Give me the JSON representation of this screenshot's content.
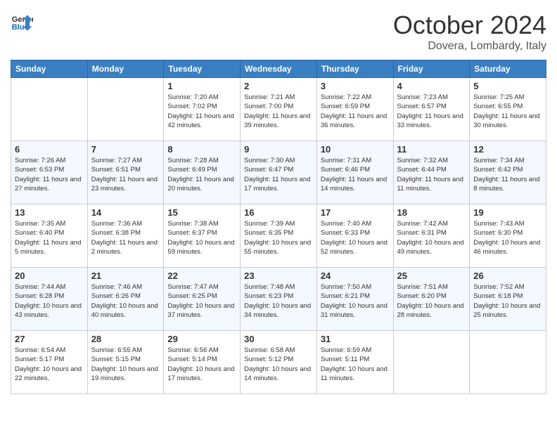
{
  "header": {
    "logo_line1": "General",
    "logo_line2": "Blue",
    "month_title": "October 2024",
    "subtitle": "Dovera, Lombardy, Italy"
  },
  "weekdays": [
    "Sunday",
    "Monday",
    "Tuesday",
    "Wednesday",
    "Thursday",
    "Friday",
    "Saturday"
  ],
  "weeks": [
    [
      {
        "day": "",
        "info": ""
      },
      {
        "day": "",
        "info": ""
      },
      {
        "day": "1",
        "info": "Sunrise: 7:20 AM\nSunset: 7:02 PM\nDaylight: 11 hours and 42 minutes."
      },
      {
        "day": "2",
        "info": "Sunrise: 7:21 AM\nSunset: 7:00 PM\nDaylight: 11 hours and 39 minutes."
      },
      {
        "day": "3",
        "info": "Sunrise: 7:22 AM\nSunset: 6:59 PM\nDaylight: 11 hours and 36 minutes."
      },
      {
        "day": "4",
        "info": "Sunrise: 7:23 AM\nSunset: 6:57 PM\nDaylight: 11 hours and 33 minutes."
      },
      {
        "day": "5",
        "info": "Sunrise: 7:25 AM\nSunset: 6:55 PM\nDaylight: 11 hours and 30 minutes."
      }
    ],
    [
      {
        "day": "6",
        "info": "Sunrise: 7:26 AM\nSunset: 6:53 PM\nDaylight: 11 hours and 27 minutes."
      },
      {
        "day": "7",
        "info": "Sunrise: 7:27 AM\nSunset: 6:51 PM\nDaylight: 11 hours and 23 minutes."
      },
      {
        "day": "8",
        "info": "Sunrise: 7:28 AM\nSunset: 6:49 PM\nDaylight: 11 hours and 20 minutes."
      },
      {
        "day": "9",
        "info": "Sunrise: 7:30 AM\nSunset: 6:47 PM\nDaylight: 11 hours and 17 minutes."
      },
      {
        "day": "10",
        "info": "Sunrise: 7:31 AM\nSunset: 6:46 PM\nDaylight: 11 hours and 14 minutes."
      },
      {
        "day": "11",
        "info": "Sunrise: 7:32 AM\nSunset: 6:44 PM\nDaylight: 11 hours and 11 minutes."
      },
      {
        "day": "12",
        "info": "Sunrise: 7:34 AM\nSunset: 6:42 PM\nDaylight: 11 hours and 8 minutes."
      }
    ],
    [
      {
        "day": "13",
        "info": "Sunrise: 7:35 AM\nSunset: 6:40 PM\nDaylight: 11 hours and 5 minutes."
      },
      {
        "day": "14",
        "info": "Sunrise: 7:36 AM\nSunset: 6:38 PM\nDaylight: 11 hours and 2 minutes."
      },
      {
        "day": "15",
        "info": "Sunrise: 7:38 AM\nSunset: 6:37 PM\nDaylight: 10 hours and 59 minutes."
      },
      {
        "day": "16",
        "info": "Sunrise: 7:39 AM\nSunset: 6:35 PM\nDaylight: 10 hours and 55 minutes."
      },
      {
        "day": "17",
        "info": "Sunrise: 7:40 AM\nSunset: 6:33 PM\nDaylight: 10 hours and 52 minutes."
      },
      {
        "day": "18",
        "info": "Sunrise: 7:42 AM\nSunset: 6:31 PM\nDaylight: 10 hours and 49 minutes."
      },
      {
        "day": "19",
        "info": "Sunrise: 7:43 AM\nSunset: 6:30 PM\nDaylight: 10 hours and 46 minutes."
      }
    ],
    [
      {
        "day": "20",
        "info": "Sunrise: 7:44 AM\nSunset: 6:28 PM\nDaylight: 10 hours and 43 minutes."
      },
      {
        "day": "21",
        "info": "Sunrise: 7:46 AM\nSunset: 6:26 PM\nDaylight: 10 hours and 40 minutes."
      },
      {
        "day": "22",
        "info": "Sunrise: 7:47 AM\nSunset: 6:25 PM\nDaylight: 10 hours and 37 minutes."
      },
      {
        "day": "23",
        "info": "Sunrise: 7:48 AM\nSunset: 6:23 PM\nDaylight: 10 hours and 34 minutes."
      },
      {
        "day": "24",
        "info": "Sunrise: 7:50 AM\nSunset: 6:21 PM\nDaylight: 10 hours and 31 minutes."
      },
      {
        "day": "25",
        "info": "Sunrise: 7:51 AM\nSunset: 6:20 PM\nDaylight: 10 hours and 28 minutes."
      },
      {
        "day": "26",
        "info": "Sunrise: 7:52 AM\nSunset: 6:18 PM\nDaylight: 10 hours and 25 minutes."
      }
    ],
    [
      {
        "day": "27",
        "info": "Sunrise: 6:54 AM\nSunset: 5:17 PM\nDaylight: 10 hours and 22 minutes."
      },
      {
        "day": "28",
        "info": "Sunrise: 6:55 AM\nSunset: 5:15 PM\nDaylight: 10 hours and 19 minutes."
      },
      {
        "day": "29",
        "info": "Sunrise: 6:56 AM\nSunset: 5:14 PM\nDaylight: 10 hours and 17 minutes."
      },
      {
        "day": "30",
        "info": "Sunrise: 6:58 AM\nSunset: 5:12 PM\nDaylight: 10 hours and 14 minutes."
      },
      {
        "day": "31",
        "info": "Sunrise: 6:59 AM\nSunset: 5:11 PM\nDaylight: 10 hours and 11 minutes."
      },
      {
        "day": "",
        "info": ""
      },
      {
        "day": "",
        "info": ""
      }
    ]
  ]
}
